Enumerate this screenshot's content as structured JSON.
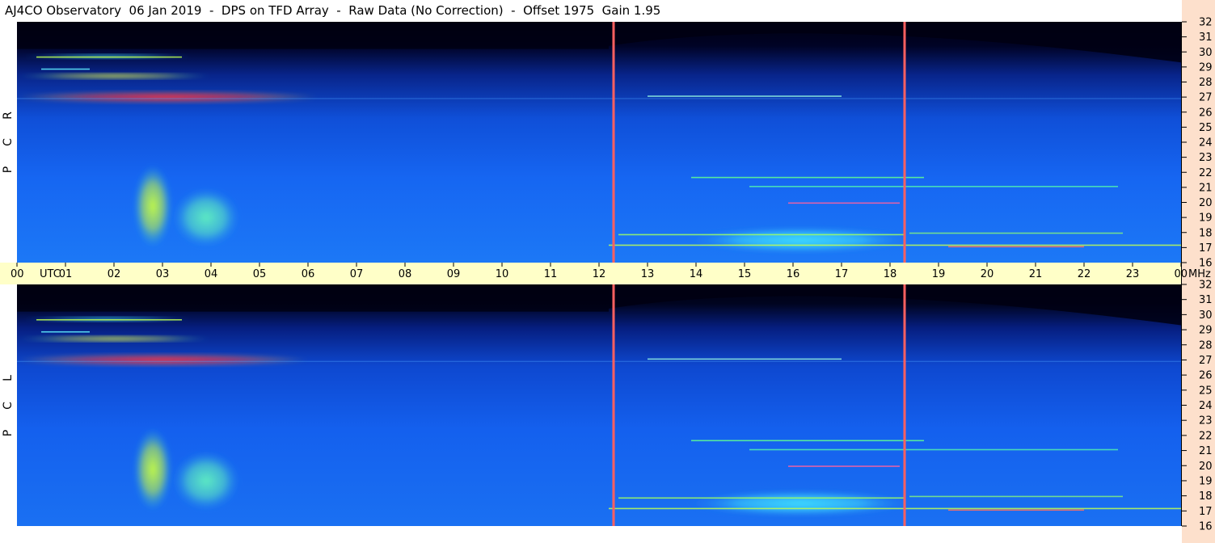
{
  "title": "AJ4CO Observatory  06 Jan 2019  -  DPS on TFD Array  -  Raw Data (No Correction)  -  Offset 1975  Gain 1.95",
  "colors": {
    "page_bg": "#ffffff",
    "time_band": "#ffffc8",
    "freq_band": "#fde0cc",
    "plot_bg_dark": "#000018",
    "plot_bg_blue": "#1a60f0",
    "marker_line": "#ff6060"
  },
  "chart_data": [
    {
      "type": "heatmap",
      "panel": "RCP",
      "side_label": [
        "R",
        "C",
        "P"
      ],
      "x_axis": {
        "units": "UTC",
        "ticks": [
          "00",
          "01",
          "02",
          "03",
          "04",
          "05",
          "06",
          "07",
          "08",
          "09",
          "10",
          "11",
          "12",
          "13",
          "14",
          "15",
          "16",
          "17",
          "18",
          "19",
          "20",
          "21",
          "22",
          "23",
          "00"
        ],
        "range_hours": [
          0,
          24
        ]
      },
      "y_axis": {
        "units": "MHz",
        "ticks": [
          "16",
          "17",
          "18",
          "19",
          "20",
          "21",
          "22",
          "23",
          "24",
          "25",
          "26",
          "27",
          "28",
          "29",
          "30",
          "31",
          "32"
        ],
        "range": [
          16,
          32
        ]
      },
      "vertical_markers_utc": [
        12.3,
        18.3
      ],
      "features": [
        {
          "utc_start": 0.0,
          "utc_end": 6.2,
          "mhz_low": 26.6,
          "mhz_high": 27.4,
          "intensity": "peak"
        },
        {
          "utc_start": 0.0,
          "utc_end": 4.0,
          "mhz_low": 28.2,
          "mhz_high": 28.6,
          "intensity": "high"
        },
        {
          "utc_start": 0.1,
          "utc_end": 3.6,
          "mhz_low": 29.6,
          "mhz_high": 29.8,
          "intensity": "medium"
        },
        {
          "utc_start": 2.4,
          "utc_end": 3.2,
          "mhz_low": 17.0,
          "mhz_high": 22.5,
          "intensity": "high"
        },
        {
          "utc_start": 3.2,
          "utc_end": 4.6,
          "mhz_low": 17.0,
          "mhz_high": 21.0,
          "intensity": "medium"
        },
        {
          "utc_start": 13.8,
          "utc_end": 18.5,
          "mhz_low": 16.6,
          "mhz_high": 18.4,
          "intensity": "medium"
        }
      ]
    },
    {
      "type": "heatmap",
      "panel": "LCP",
      "side_label": [
        "L",
        "C",
        "P"
      ],
      "x_axis": {
        "units": "UTC",
        "range_hours": [
          0,
          24
        ]
      },
      "y_axis": {
        "units": "MHz",
        "ticks": [
          "16",
          "17",
          "18",
          "19",
          "20",
          "21",
          "22",
          "23",
          "24",
          "25",
          "26",
          "27",
          "28",
          "29",
          "30",
          "31",
          "32"
        ],
        "range": [
          16,
          32
        ]
      },
      "vertical_markers_utc": [
        12.3,
        18.3
      ],
      "features": [
        {
          "utc_start": 0.0,
          "utc_end": 6.0,
          "mhz_low": 26.6,
          "mhz_high": 27.4,
          "intensity": "peak"
        },
        {
          "utc_start": 0.0,
          "utc_end": 4.0,
          "mhz_low": 28.2,
          "mhz_high": 28.6,
          "intensity": "high"
        },
        {
          "utc_start": 0.1,
          "utc_end": 3.6,
          "mhz_low": 29.6,
          "mhz_high": 29.8,
          "intensity": "medium"
        },
        {
          "utc_start": 2.4,
          "utc_end": 3.2,
          "mhz_low": 17.0,
          "mhz_high": 22.5,
          "intensity": "high"
        },
        {
          "utc_start": 3.2,
          "utc_end": 4.6,
          "mhz_low": 17.0,
          "mhz_high": 21.0,
          "intensity": "medium"
        },
        {
          "utc_start": 13.8,
          "utc_end": 18.5,
          "mhz_low": 16.6,
          "mhz_high": 18.4,
          "intensity": "medium"
        }
      ]
    }
  ]
}
